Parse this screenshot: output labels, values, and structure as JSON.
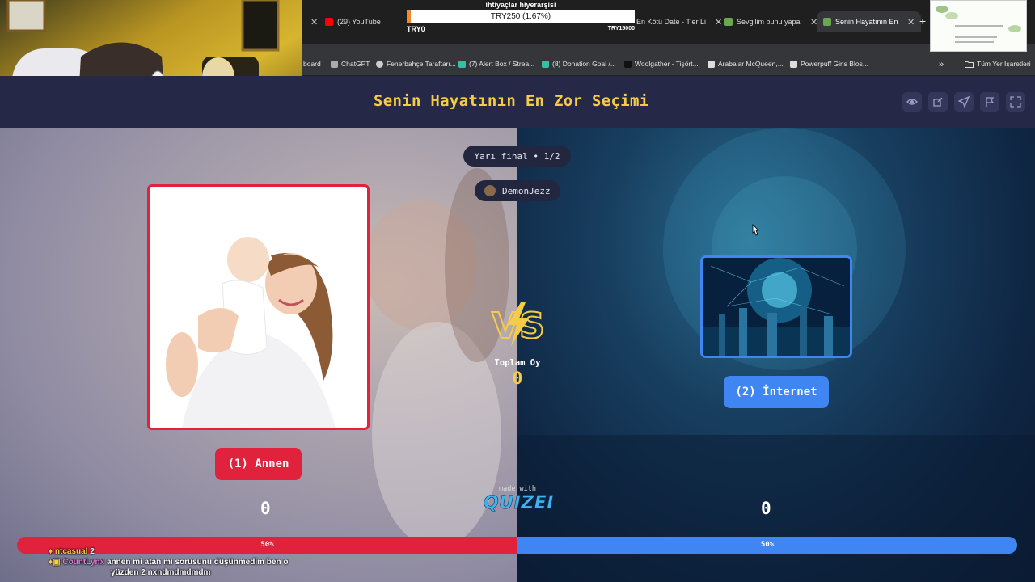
{
  "browser": {
    "tabs": [
      {
        "label": "",
        "color": "#888"
      },
      {
        "label": "(29) YouTube",
        "color": "#ff0000"
      },
      {
        "label": "En Kötü Date - Tier Li",
        "color": "#777"
      },
      {
        "label": "Sevgilim bunu yapar",
        "color": "#6aa84f"
      },
      {
        "label": "Senin Hayatının En Z",
        "color": "#6aa84f"
      }
    ],
    "bookmarks": [
      "board",
      "ChatGPT",
      "Fenerbahçe Taraftarı...",
      "(7) Alert Box / Strea...",
      "(8) Donation Goal /...",
      "Woolgather - Tişört...",
      "Arabalar McQueen,...",
      "Powerpuff Girls Blos..."
    ],
    "all_bookmarks_label": "Tüm Yer İşaretleri"
  },
  "goal": {
    "title": "ihtiyaçlar hiyerarşisi",
    "amount_text": "TRY250 (1.67%)",
    "min": "TRY0",
    "max": "TRY15000",
    "progress_fraction": 0.0167
  },
  "quiz": {
    "title": "Senin Hayatının En Zor Seçimi",
    "round": "Yarı final • 1/2",
    "host": "DemonJezz",
    "total_label": "Toplam Oy",
    "total_value": "0",
    "left": {
      "button": "(1) Annen",
      "votes": "0",
      "percent": "50%"
    },
    "right": {
      "button": "(2) İnternet",
      "votes": "0",
      "percent": "50%"
    },
    "made_with": "made with",
    "logo": "QUIZEI",
    "vs_text": "VS"
  },
  "chat": [
    {
      "user": "ntcasual",
      "message": "2",
      "user_color": "#f6cc47"
    },
    {
      "user": "CountLynx",
      "message": "annen mi atan mı sorusunu düşünmedim ben o",
      "user_color": "#e07bd8"
    },
    {
      "user": "",
      "message": "yüzden 2 nxndmdmdmdm",
      "user_color": "#ffffff"
    }
  ],
  "colors": {
    "left_accent": "#e0223d",
    "right_accent": "#3f86f3",
    "title_accent": "#f6cc47"
  }
}
